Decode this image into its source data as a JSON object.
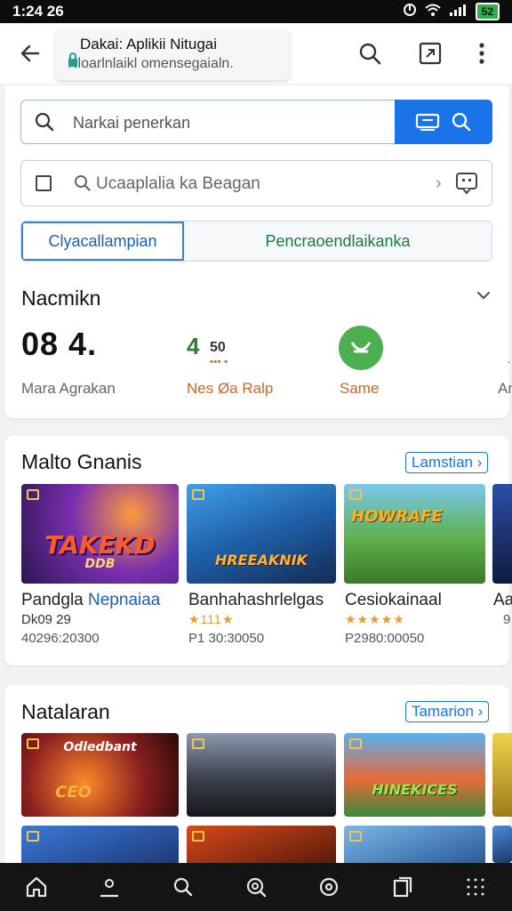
{
  "status": {
    "time": "1:24 26",
    "battery": "52"
  },
  "browser": {
    "url_title": "Dakai: Aplikii Nitugai",
    "url_sub": "Nloarlnlaikl omensegaialn."
  },
  "search": {
    "placeholder": "Narkai penerkan"
  },
  "app_search": {
    "placeholder": "Ucaaplalia ka Beagan"
  },
  "segment": {
    "left": "Clyacallampian",
    "right": "Pencraoendlaikanka"
  },
  "section_stats": {
    "title": "Nacmikn",
    "big_value": "08 4.",
    "big_label": "Mara Agrakan",
    "rating": "4",
    "rating_small": "50",
    "rating_label": "Nes Øa Ralp",
    "same_label": "Same",
    "edge_label": "An"
  },
  "section_games": {
    "title": "Malto Gnanis",
    "more": "Lamstian",
    "items": [
      {
        "title": "Pandgla",
        "title_accent": "Nepnaiaa",
        "count": "Dk09 29",
        "meta": "40296:20300",
        "logo": "TAKEKD",
        "logo_sub": "DDB"
      },
      {
        "title": "Banhahashrlelgas",
        "stars": "★111★",
        "meta": "P1 30:30050",
        "logo": "HREEAKNIK"
      },
      {
        "title": "Cesiokainaal",
        "stars": "★★★★★",
        "meta": "P2980:00050",
        "logo": "HOWRAFE"
      },
      {
        "title": "Aa",
        "meta": "9",
        "logo": ""
      }
    ]
  },
  "section_new": {
    "title": "Natalaran",
    "more": "Tamarion",
    "items": [
      {
        "logo": "Odledbant",
        "logo_sub": "CEO"
      },
      {
        "logo": ""
      },
      {
        "logo": "HINEKICES"
      },
      {
        "logo": ""
      }
    ]
  },
  "colors": {
    "accent": "#1a73e8",
    "green": "#4caf50",
    "star": "#e89a2a"
  }
}
